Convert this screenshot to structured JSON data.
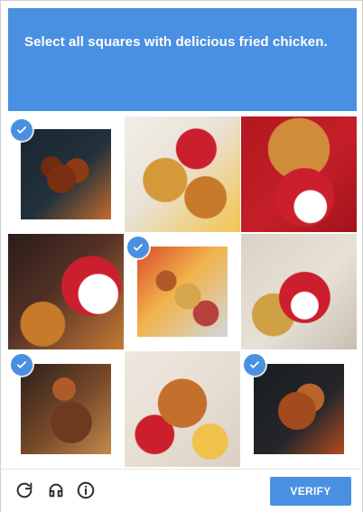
{
  "challenge": {
    "instruction": "Select all squares with delicious fried chicken.",
    "accent": "#4a90e2"
  },
  "grid": {
    "tiles": [
      {
        "selected": true
      },
      {
        "selected": false
      },
      {
        "selected": false
      },
      {
        "selected": false
      },
      {
        "selected": true
      },
      {
        "selected": false
      },
      {
        "selected": true
      },
      {
        "selected": false
      },
      {
        "selected": true
      }
    ]
  },
  "footer": {
    "icons": [
      "reload-icon",
      "audio-icon",
      "info-icon"
    ],
    "verify_label": "VERIFY"
  }
}
